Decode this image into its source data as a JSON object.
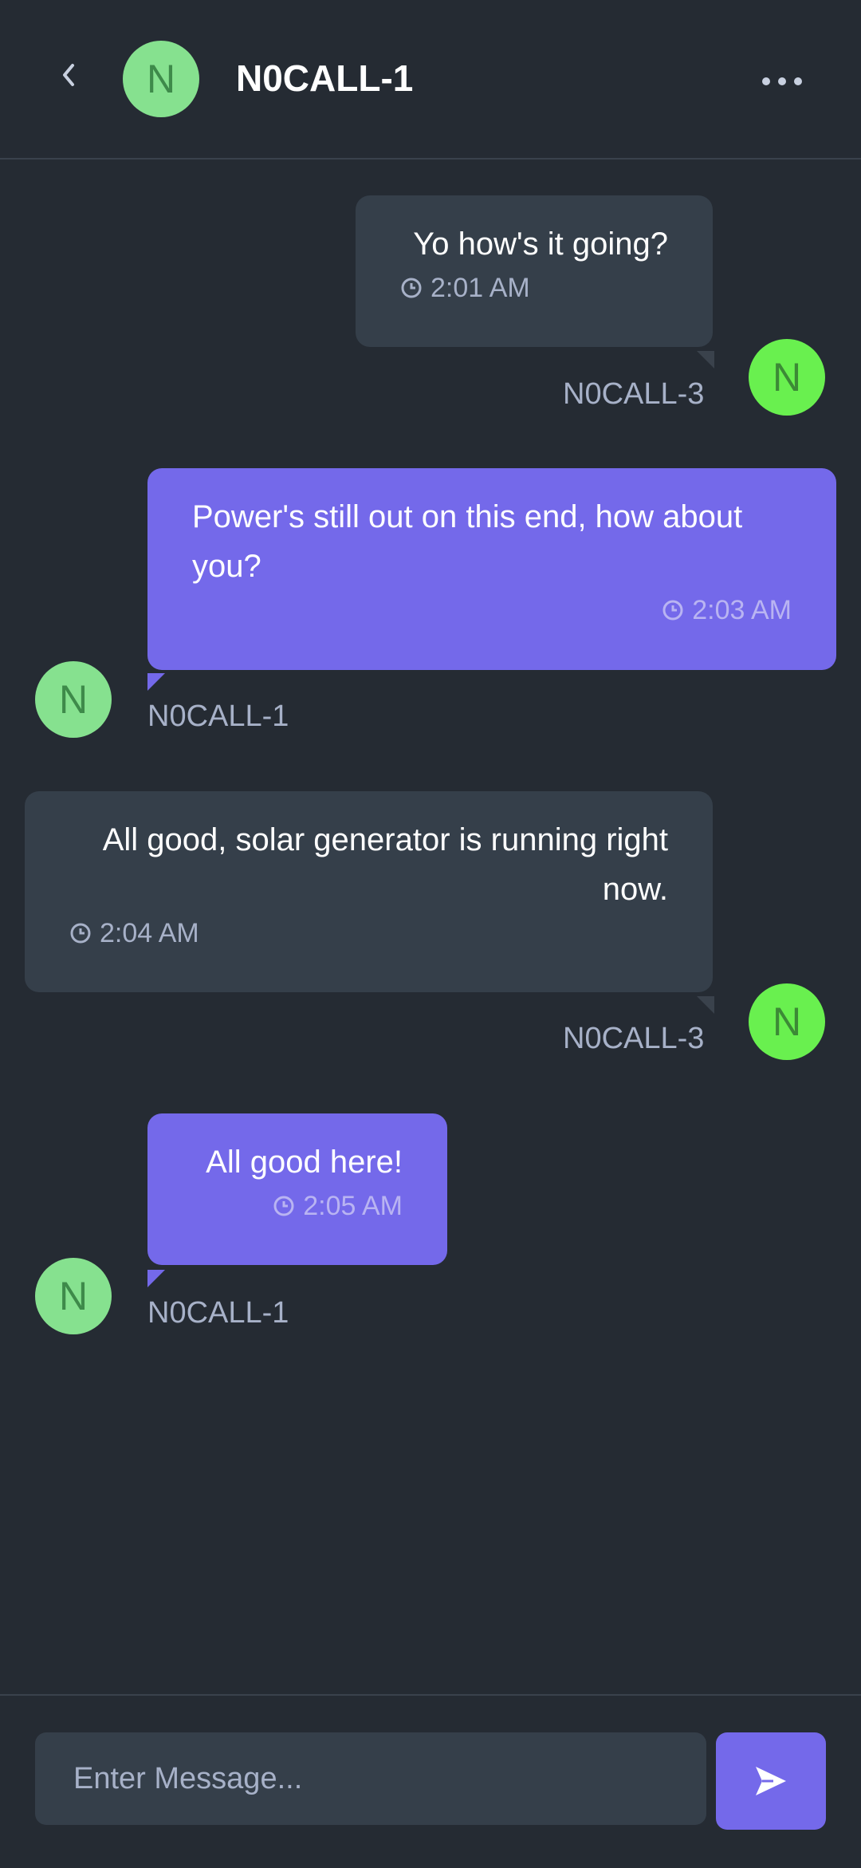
{
  "header": {
    "title": "N0CALL-1",
    "avatar_initial": "N"
  },
  "messages": [
    {
      "text": "Yo how's it going?",
      "time": "2:01 AM",
      "sender": "N0CALL-3",
      "initial": "N"
    },
    {
      "text": "Power's still out on this end, how about you?",
      "time": "2:03 AM",
      "sender": "N0CALL-1",
      "initial": "N"
    },
    {
      "text": "All good, solar generator is running right now.",
      "time": "2:04 AM",
      "sender": "N0CALL-3",
      "initial": "N"
    },
    {
      "text": "All good here!",
      "time": "2:05 AM",
      "sender": "N0CALL-1",
      "initial": "N"
    }
  ],
  "composer": {
    "placeholder": "Enter Message..."
  },
  "colors": {
    "background": "#252b33",
    "bubble_dark": "#353f4a",
    "bubble_purple": "#7469ea",
    "avatar_light_green": "#86e18f",
    "avatar_bright_green": "#69f04f",
    "muted_text": "#a7b1c8"
  },
  "icons": {
    "back": "chevron-left-icon",
    "more": "more-horizontal-icon",
    "clock": "clock-icon",
    "send": "send-icon"
  }
}
